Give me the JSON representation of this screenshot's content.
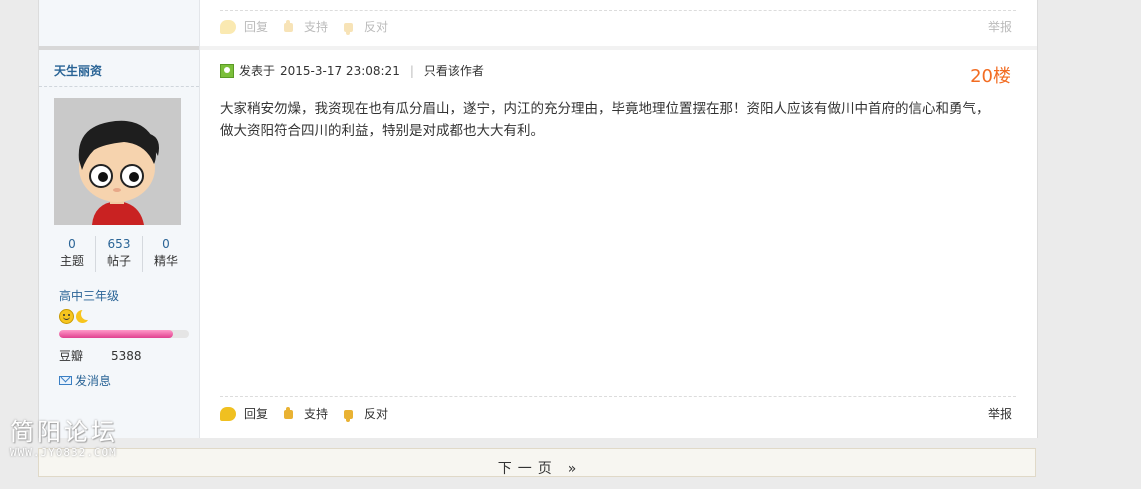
{
  "prev_post": {
    "actions": {
      "reply": "回复",
      "support": "支持",
      "oppose": "反对"
    },
    "report": "举报"
  },
  "author": {
    "name": "天生丽资",
    "stats": [
      {
        "value": "0",
        "label": "主题"
      },
      {
        "value": "653",
        "label": "帖子"
      },
      {
        "value": "0",
        "label": "精华"
      }
    ],
    "level": "高中三年级",
    "level_progress": 0.88,
    "points_label": "豆瓣",
    "points_value": "5388",
    "message_label": "发消息"
  },
  "post": {
    "posted_prefix": "发表于",
    "posted_time": "2015-3-17 23:08:21",
    "only_author": "只看该作者",
    "floor": "20楼",
    "content": "大家稍安勿燥，我资现在也有瓜分眉山，遂宁，内江的充分理由，毕竟地理位置摆在那！资阳人应该有做川中首府的信心和勇气，做大资阳符合四川的利益，特别是对成都也大大有利。",
    "actions": {
      "reply": "回复",
      "support": "支持",
      "oppose": "反对"
    },
    "report": "举报"
  },
  "pager": {
    "next": "下一页",
    "arrow": "»"
  },
  "watermark": {
    "title": "简阳论坛",
    "url": "WWW.JY0832.COM"
  },
  "colors": {
    "floor": "#f26c22",
    "link": "#2a6496",
    "progress": "#e0408f"
  }
}
